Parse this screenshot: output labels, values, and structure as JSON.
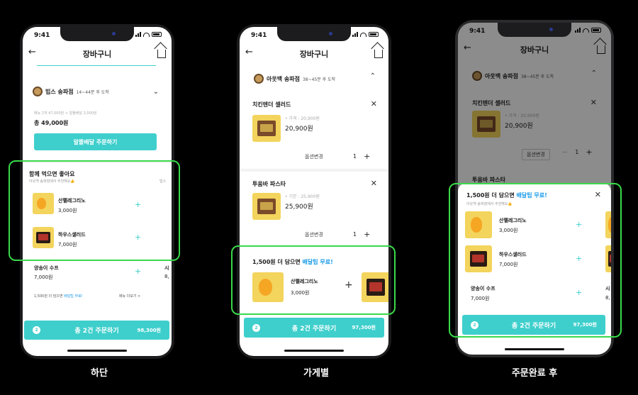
{
  "status": {
    "time": "9:41"
  },
  "header": {
    "title": "장바구니"
  },
  "screens": {
    "bottom": {
      "store_name": "빕스 송파점",
      "store_eta": "14~44분 후 도착",
      "summary": "메뉴 2개 47,000원 + 알뜰배달 2,000원",
      "total": "총 49,000원",
      "order_button": "알뜰배달 주문하기",
      "rec_title": "함께 먹으면 좋아요",
      "rec_sub": "아웃백 송파점에서 추천해요👍",
      "rec_side": "빕스",
      "rec_items": [
        {
          "name": "산펠레그리노",
          "price": "3,000원"
        },
        {
          "name": "하우스샐러드",
          "price": "7,000원"
        },
        {
          "name": "양송이 수프",
          "price": "7,000원"
        }
      ],
      "rec_clip_name": "시",
      "rec_clip_price": "8,",
      "delivery_tip": "1,500원 더 담으면",
      "delivery_tip_hl": "배달팁 무료!",
      "more_menu": "메뉴 더보기 >",
      "cta": {
        "badge": "2",
        "label": "총 2건 주문하기",
        "amount": "98,300원"
      }
    },
    "store": {
      "store_name": "아웃백 송파점",
      "store_eta": "38~45분 후 도착",
      "items": [
        {
          "name": "치킨텐더 셀러드",
          "price_label": "• 가격 : 20,900원",
          "price": "20,900원",
          "option": "옵션변경",
          "qty": "1"
        },
        {
          "name": "투움바 파스타",
          "price_label": "• 기본 : 25,900원",
          "price": "25,900원",
          "option": "옵션변경",
          "qty": "1"
        }
      ],
      "rec_title": "1,500원 더 담으면",
      "rec_title_hl": "배달팁 무료!",
      "rec_item": {
        "name": "산펠레그리노",
        "price": "3,000원"
      },
      "cta": {
        "badge": "2",
        "label": "총 2건 주문하기",
        "amount": "97,300원"
      }
    },
    "after": {
      "store_name": "아웃백 송파점",
      "store_eta": "38~45분 후 도착",
      "item": {
        "name": "치킨텐더 셀러드",
        "price_label": "• 가격 : 20,900원",
        "price": "20,900원",
        "option": "옵션변경",
        "qty": "1"
      },
      "item2_name": "투움바 파스타",
      "sheet_title": "1,500원 더 담으면",
      "sheet_title_hl": "배달팁 무료!",
      "sheet_sub": "아웃백 송파점에서 추천해요👍",
      "rec_items": [
        {
          "name": "산펠레그리노",
          "price": "3,000원"
        },
        {
          "name": "하우스샐러드",
          "price": "7,000원"
        },
        {
          "name": "양송이 수프",
          "price": "7,000원"
        }
      ],
      "rec_clip_name": "시",
      "rec_clip_price": "8,",
      "cta": {
        "badge": "2",
        "label": "총 2건 주문하기",
        "amount": "97,300원"
      }
    }
  },
  "captions": {
    "bottom": "하단",
    "store": "가게별",
    "after": "주문완료 후"
  },
  "colors": {
    "accent": "#3ecfcc",
    "highlight": "#1a9be8",
    "annotation": "#39d94a"
  }
}
